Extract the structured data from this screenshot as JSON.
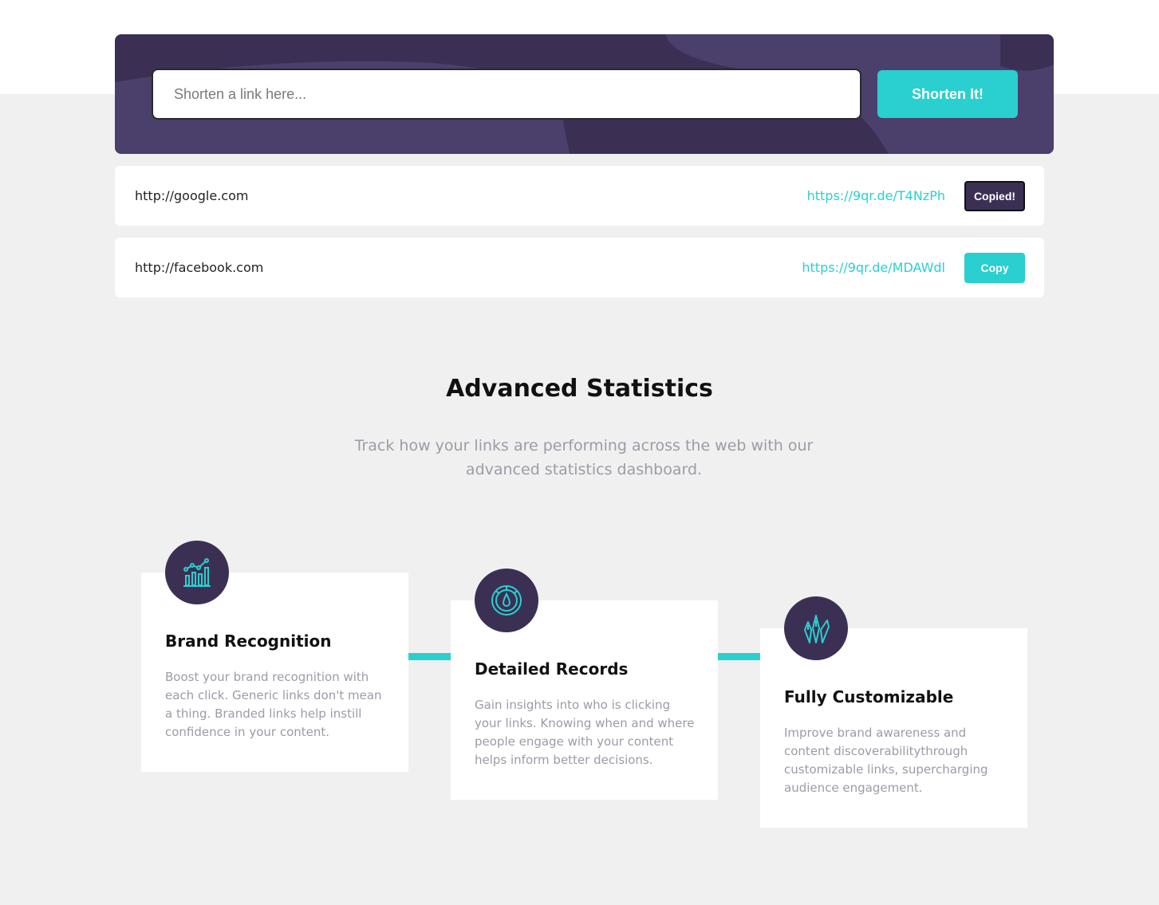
{
  "shorten": {
    "placeholder": "Shorten a link here...",
    "button_label": "Shorten It!"
  },
  "results": [
    {
      "original": "http://google.com",
      "short": "https://9qr.de/T4NzPh",
      "button_label": "Copied!",
      "copied": true
    },
    {
      "original": "http://facebook.com",
      "short": "https://9qr.de/MDAWdl",
      "button_label": "Copy",
      "copied": false
    }
  ],
  "stats": {
    "title": "Advanced Statistics",
    "subtitle": "Track how your links are performing across the web with our advanced statistics dashboard.",
    "cards": [
      {
        "icon": "brand-recognition-icon",
        "title": "Brand Recognition",
        "text": "Boost your brand recognition with each click. Generic links don't mean a thing. Branded links help instill confidence in your content."
      },
      {
        "icon": "detailed-records-icon",
        "title": "Detailed Records",
        "text": "Gain insights into who is clicking your links. Knowing when and where people engage with your content helps inform better decisions."
      },
      {
        "icon": "fully-customizable-icon",
        "title": "Fully Customizable",
        "text": "Improve brand awareness and content discoverabilitythrough customizable links, supercharging audience engagement."
      }
    ]
  },
  "colors": {
    "cyan": "#2acfcf",
    "dark_violet": "#3b3054",
    "gray_text": "#9e9aa7",
    "background": "#f0f0f0"
  }
}
